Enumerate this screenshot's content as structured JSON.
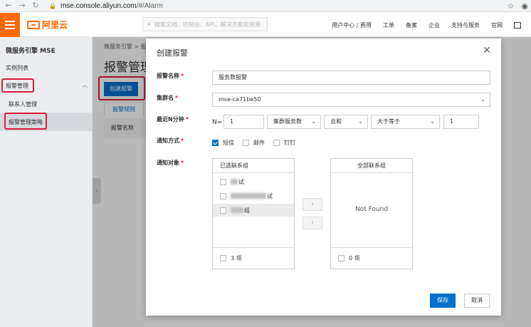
{
  "browser": {
    "url_host": "mse.console.aliyun.com",
    "url_path": "/#/Alarm"
  },
  "topnav": {
    "logo_text": "阿里云",
    "search_placeholder": "搜索文档、控制台、API、解决方案和资源",
    "links": [
      "用户中心 / 费用",
      "工单",
      "备案",
      "企业",
      "支持与服务",
      "官网"
    ]
  },
  "sidebar": {
    "title": "微服务引擎 MSE",
    "items": {
      "instances": "实例列表",
      "alarm": "报警管理",
      "contacts": "联系人管理",
      "policies": "报警管理策略"
    }
  },
  "page": {
    "breadcrumb": "微服务引擎  >  报",
    "title": "报警管理",
    "create_button": "创建报警",
    "tab": "报警规则",
    "table_header": "报警名称"
  },
  "modal": {
    "title": "创建报警",
    "labels": {
      "name": "报警名称",
      "cluster": "集群名",
      "recent": "最近N分钟",
      "notify_method": "通知方式",
      "notify_target": "通知对象"
    },
    "name_value": "服务数报警",
    "cluster_value": "mse-ca71be50",
    "n_prefix": "N=",
    "n_value": "1",
    "metric_value": "集群服务数",
    "aggregate_value": "总和",
    "operator_value": "大于等于",
    "threshold_value": "1",
    "notify_methods": [
      {
        "label": "短信",
        "checked": true
      },
      {
        "label": "邮件",
        "checked": false
      },
      {
        "label": "钉钉",
        "checked": false
      }
    ],
    "transfer": {
      "left_title": "已选联系组",
      "left_items": [
        "试",
        "试",
        "组"
      ],
      "left_count": "3 项",
      "right_title": "全部联系组",
      "right_empty": "Not Found",
      "right_count": "0 项"
    },
    "save_button": "保存",
    "cancel_button": "取消"
  }
}
